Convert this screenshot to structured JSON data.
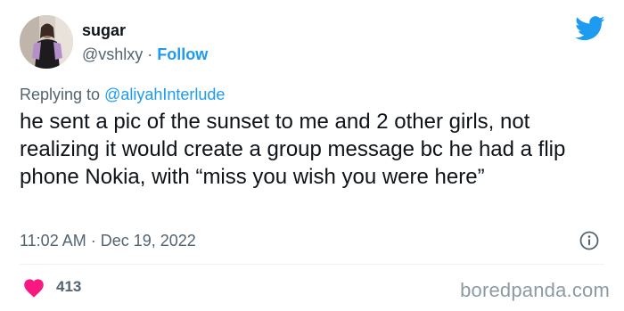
{
  "author": {
    "name": "sugar",
    "handle": "@vshlxy",
    "separator": " · ",
    "follow_label": "Follow"
  },
  "reply": {
    "prefix": "Replying to ",
    "mention": "@aliyahInterlude"
  },
  "tweet": {
    "text": "he sent a pic of the sunset to me and 2 other girls, not realizing it would create a group message bc he had a flip phone Nokia, with “miss you wish you were here”",
    "time": "11:02 AM",
    "date": "Dec 19, 2022",
    "separator": " · ",
    "likes": "413"
  },
  "watermark": "boredpanda.com",
  "icons": {
    "platform": "twitter-bird-icon",
    "info": "info-icon",
    "like": "heart-icon"
  },
  "colors": {
    "link": "#1d9bf0",
    "heart": "#f91880",
    "muted": "#536471",
    "text": "#0f1419"
  }
}
